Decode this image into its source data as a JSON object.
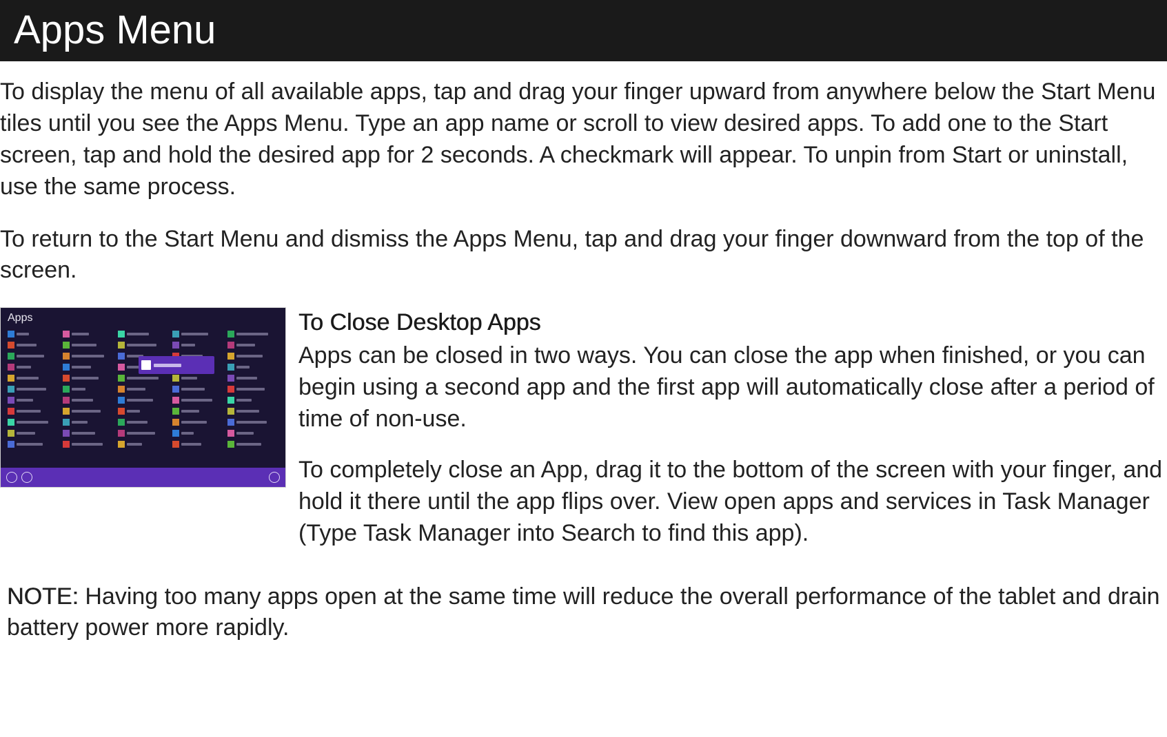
{
  "header": {
    "title": "Apps Menu"
  },
  "paragraphs": {
    "p1": "To display the menu of all available apps, tap and drag your finger upward from anywhere below the Start Menu tiles until you see the Apps Menu. Type an app name or scroll to view desired apps. To add one to the Start screen, tap and hold the desired app for 2 seconds. A checkmark will appear. To unpin from Start or uninstall, use the same process.",
    "p2": "To return to the Start Menu and dismiss the Apps Menu, tap and drag your finger downward from the top of the screen."
  },
  "screenshot": {
    "title": "Apps",
    "icon_colors": [
      "#2e7cd6",
      "#d64a2e",
      "#2ba85a",
      "#b53a7a",
      "#d6a52e",
      "#3a9fb5",
      "#7a4ab5",
      "#d63a3a",
      "#3ad6a5",
      "#b5b53a",
      "#4a6bd6",
      "#d65a9f",
      "#5ab53a",
      "#d6832e"
    ]
  },
  "close_section": {
    "heading": "To Close Desktop Apps",
    "p1": "Apps can be closed in two ways. You can close the app when finished, or you can begin using a second app and the first app will automatically close after a period of time of non-use.",
    "p2": "To completely close an App, drag it to the bottom of the screen with your finger, and hold it there until the app flips over. View open apps and services in Task Manager (Type Task Manager into Search to find this app)."
  },
  "note": {
    "label": "NOTE:",
    "text": " Having too many apps open at the same time will reduce the overall performance of the tablet and drain battery power more rapidly."
  }
}
